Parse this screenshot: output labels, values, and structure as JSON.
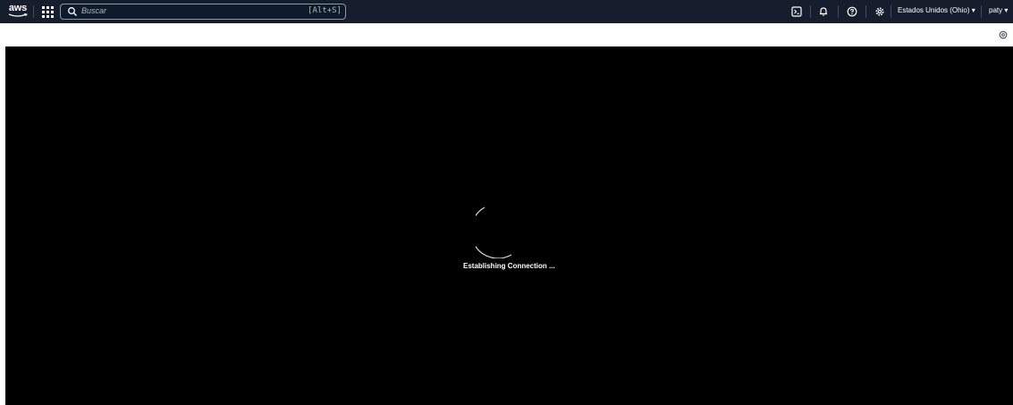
{
  "topbar": {
    "logo": {
      "text": "aws",
      "icon": "aws-logo"
    },
    "services_icon": "apps-grid-icon",
    "search": {
      "placeholder": "Buscar",
      "shortcut": "[Alt+S]",
      "icon": "search-icon"
    },
    "icons": [
      "cloudshell-icon",
      "bell-icon",
      "help-icon",
      "gear-icon"
    ],
    "region": "Estados Unidos (Ohio) ▾",
    "user": "paty ▾"
  },
  "subbar": {
    "settings_icon": "settings-icon"
  },
  "console": {
    "status_text": "Establishing Connection ..."
  },
  "colors": {
    "topbar_bg": "#161e2d",
    "console_bg": "#000000",
    "text": "#ffffff"
  }
}
